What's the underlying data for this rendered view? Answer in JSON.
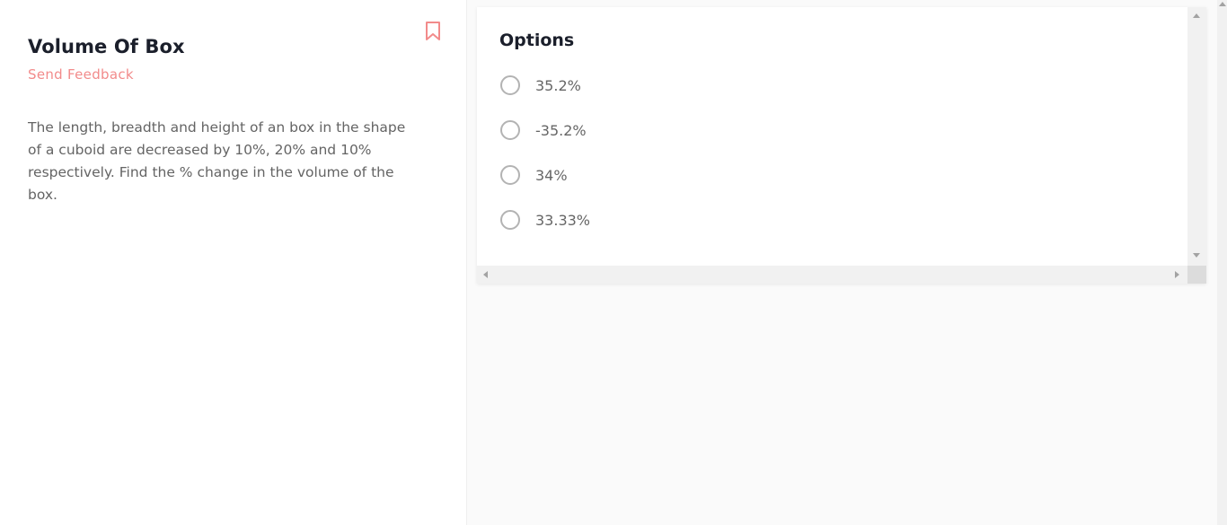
{
  "question": {
    "title": "Volume Of Box",
    "feedback_label": "Send Feedback",
    "text": "The length, breadth and height of an box in the shape of a cuboid are decreased by 10%, 20% and 10% respectively. Find the % change in the volume of the box."
  },
  "options": {
    "heading": "Options",
    "items": [
      {
        "label": "35.2%"
      },
      {
        "label": "-35.2%"
      },
      {
        "label": "34%"
      },
      {
        "label": "33.33%"
      }
    ]
  },
  "colors": {
    "accent": "#f28b8b",
    "title": "#1b1f2b",
    "body_text": "#646464",
    "radio_border": "#b3b3b3"
  },
  "icons": {
    "bookmark": "bookmark-icon",
    "scroll_up": "scroll-up-arrow-icon",
    "scroll_down": "scroll-down-arrow-icon",
    "scroll_left": "scroll-left-arrow-icon",
    "scroll_right": "scroll-right-arrow-icon"
  }
}
